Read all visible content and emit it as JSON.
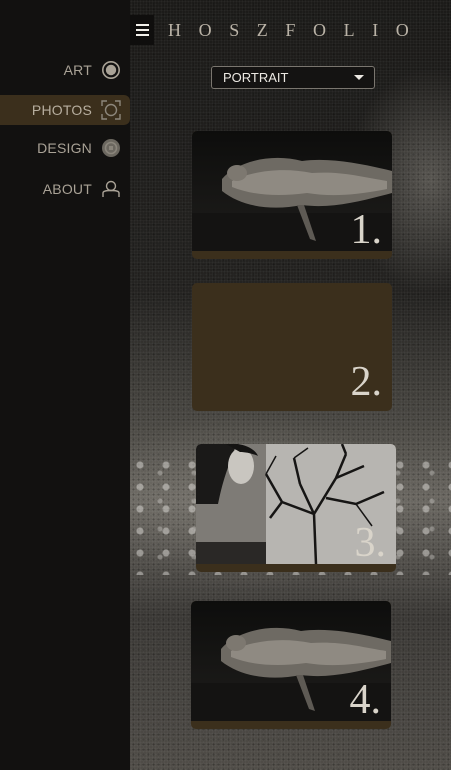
{
  "brand": "HOSZFOLIO",
  "nav": {
    "items": [
      {
        "label": "ART",
        "icon": "circle-icon"
      },
      {
        "label": "PHOTOS",
        "icon": "camera-focus-icon"
      },
      {
        "label": "DESIGN",
        "icon": "palette-icon"
      },
      {
        "label": "ABOUT",
        "icon": "person-icon"
      }
    ],
    "active": "PHOTOS"
  },
  "filter": {
    "selected": "PORTRAIT"
  },
  "cards": [
    {
      "number": "1."
    },
    {
      "number": "2."
    },
    {
      "number": "3."
    },
    {
      "number": "4."
    }
  ],
  "colors": {
    "sidebar": "#121110",
    "accent": "#3b2f1c",
    "text": "#a9a296",
    "brand": "#b9b2a6"
  }
}
